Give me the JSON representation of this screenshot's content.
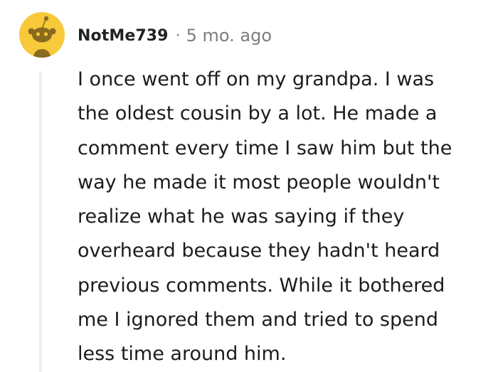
{
  "comment": {
    "username": "NotMe739",
    "separator": "·",
    "timestamp": "5 mo. ago",
    "avatar_icon": "snoo-avatar-icon",
    "avatar_color": "#F7C93B",
    "body_lines": [
      "I once went off on my grandpa. I was",
      "the oldest cousin by a lot. He made a",
      "comment every time I saw him but the",
      "way he made it most people wouldn't",
      "realize what he was saying if they",
      "overheard because they hadn't heard",
      "previous comments. While it bothered",
      "me I ignored them and tried to spend",
      "less time around him."
    ]
  }
}
